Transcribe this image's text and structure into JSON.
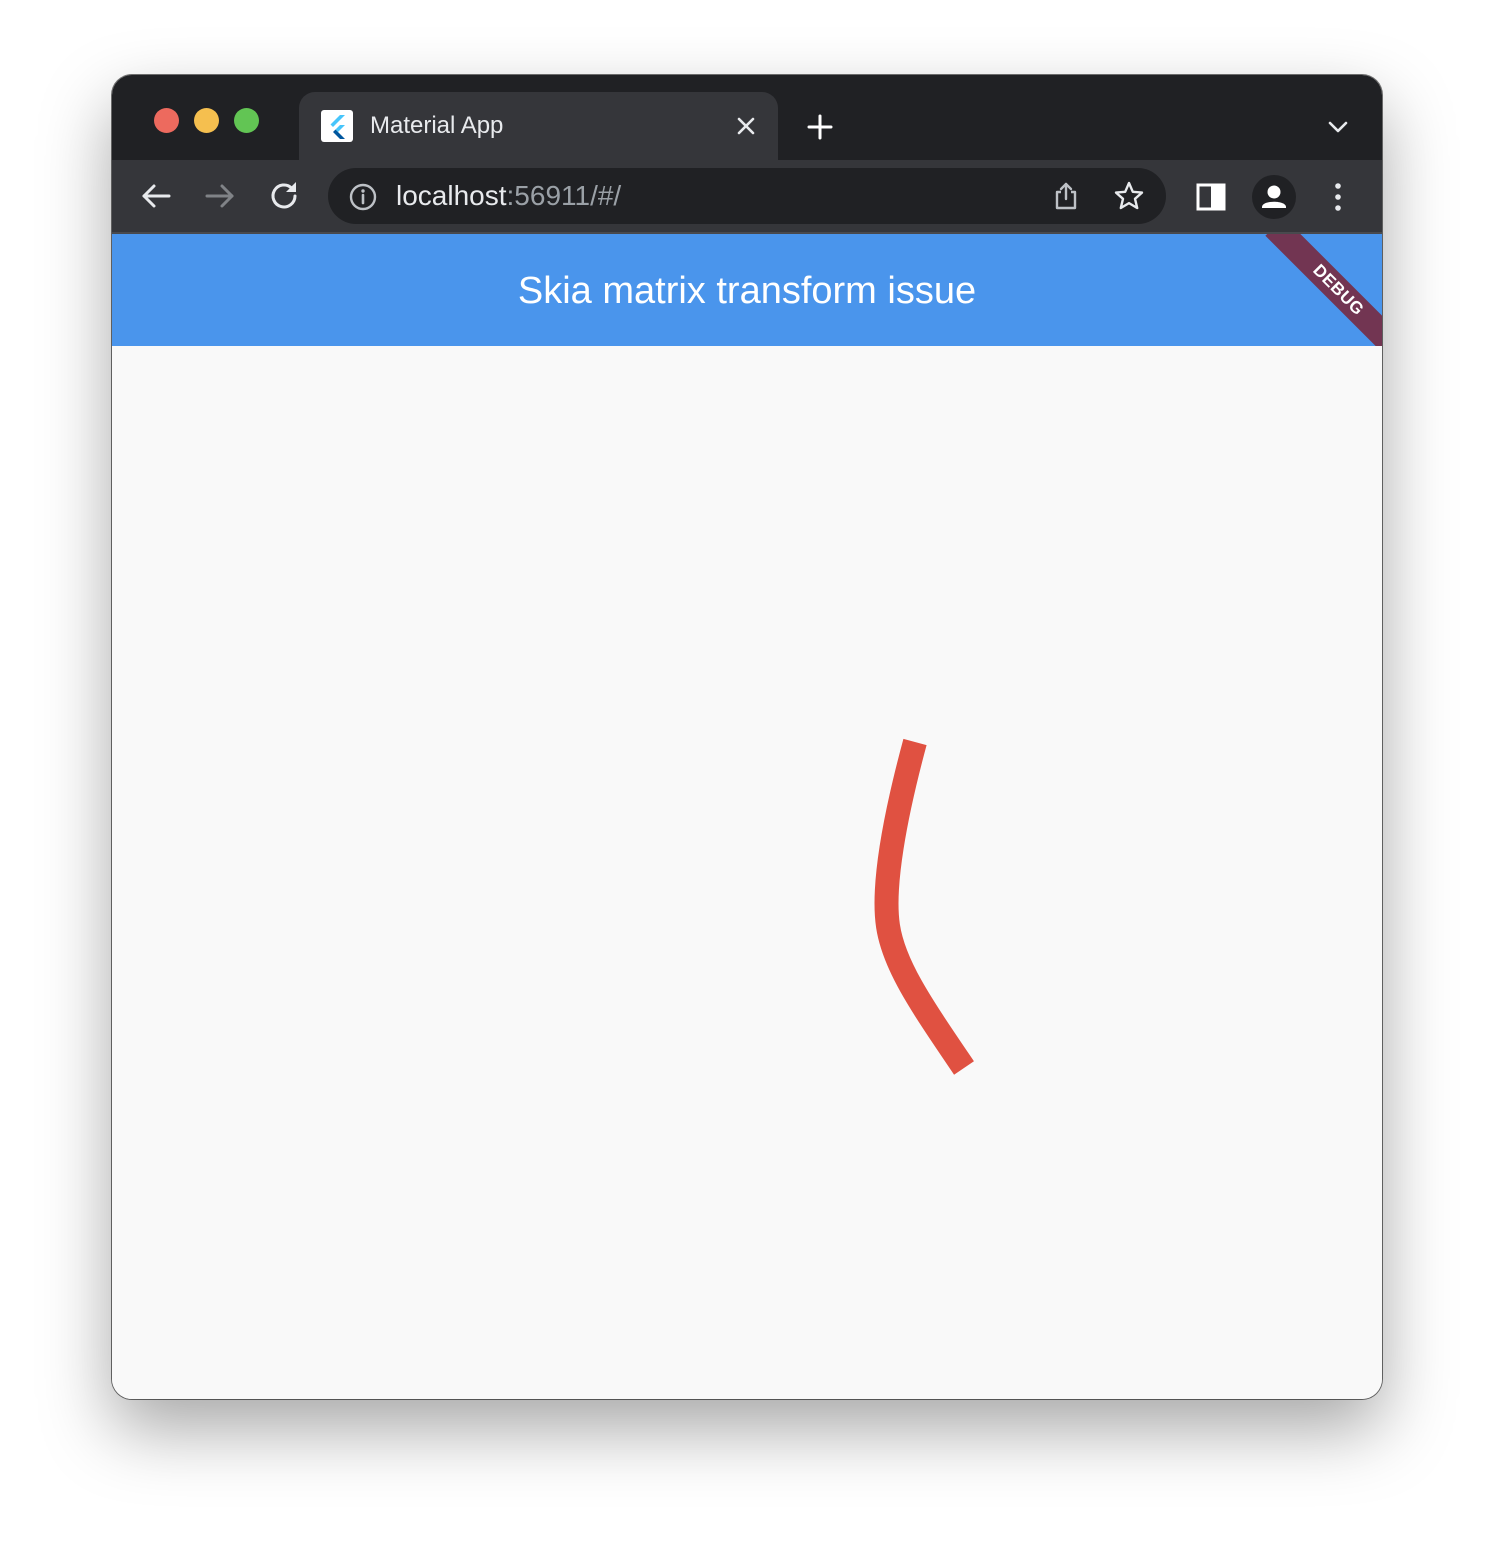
{
  "browser": {
    "tab": {
      "title": "Material App",
      "favicon": "flutter-logo-icon"
    },
    "url": {
      "host": "localhost",
      "rest": ":56911/#/"
    },
    "icons": {
      "back": "arrow-left-icon",
      "forward": "arrow-right-icon",
      "reload": "reload-icon",
      "info": "info-icon",
      "share": "share-icon",
      "bookmark": "star-icon",
      "side_panel": "side-panel-icon",
      "profile": "person-icon",
      "menu": "kebab-menu-icon",
      "new_tab": "plus-icon",
      "tab_close": "close-icon",
      "tab_search": "chevron-down-icon"
    },
    "colors": {
      "tabstrip": "#202124",
      "toolbar": "#35363a",
      "traffic_close": "#ed6a5e",
      "traffic_min": "#f5bf4f",
      "traffic_max": "#62c554"
    }
  },
  "app": {
    "title": "Skia matrix transform issue",
    "debug_banner": "DEBUG",
    "colors": {
      "appbar": "#4a95ec",
      "background": "#f9f9f9",
      "stroke": "#e05141"
    }
  }
}
